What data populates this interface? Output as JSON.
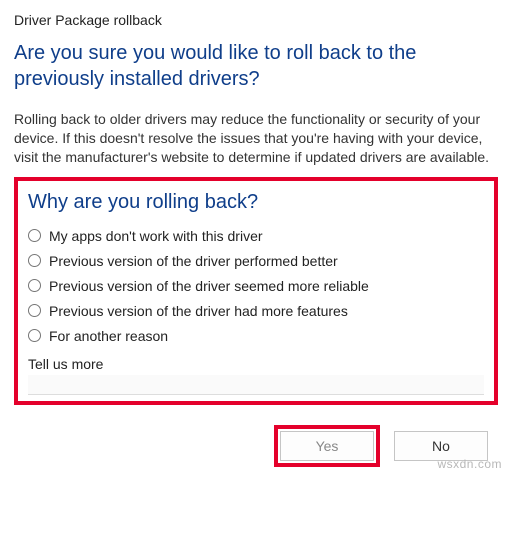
{
  "title": "Driver Package rollback",
  "heading": "Are you sure you would like to roll back to the previously installed drivers?",
  "body": "Rolling back to older drivers may reduce the functionality or security of your device. If this doesn't resolve the issues that you're having with your device, visit the manufacturer's website to determine if updated drivers are available.",
  "sub_heading": "Why are you rolling back?",
  "reasons": [
    "My apps don't work with this driver",
    "Previous version of the driver performed better",
    "Previous version of the driver seemed more reliable",
    "Previous version of the driver had more features",
    "For another reason"
  ],
  "tell_more_label": "Tell us more",
  "tell_more_value": "",
  "buttons": {
    "yes": "Yes",
    "no": "No"
  },
  "watermark": "wsxdn.com"
}
